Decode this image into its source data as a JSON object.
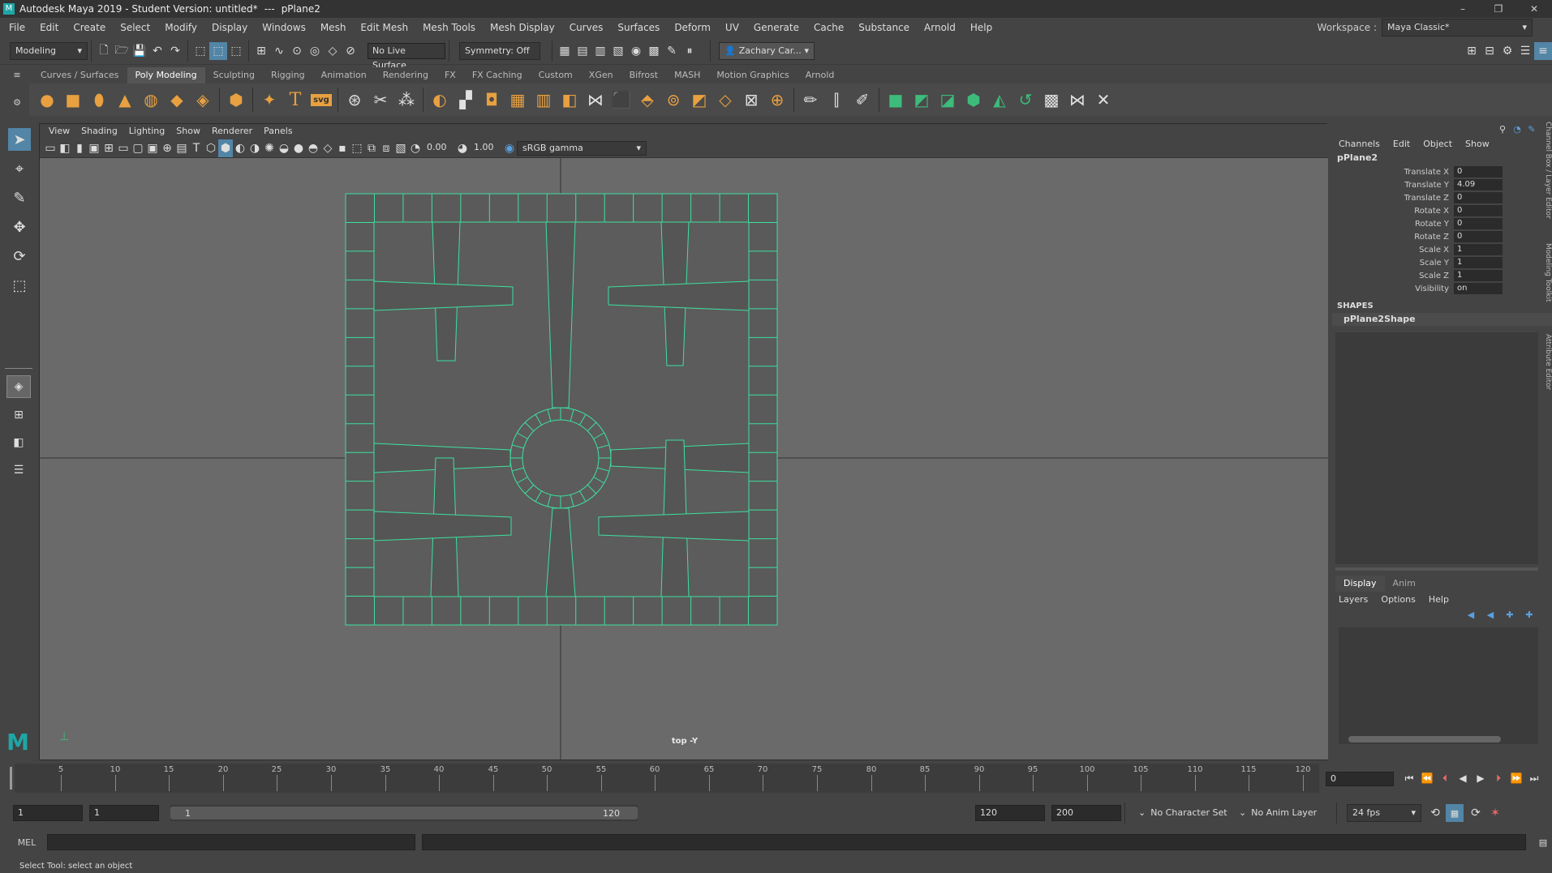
{
  "title_bar": {
    "app_title": "Autodesk Maya 2019 - Student Version: untitled*",
    "separator": "---",
    "object": "pPlane2",
    "minimize": "–",
    "maximize": "❐",
    "close": "✕"
  },
  "menubar": {
    "items": [
      "File",
      "Edit",
      "Create",
      "Select",
      "Modify",
      "Display",
      "Windows",
      "Mesh",
      "Edit Mesh",
      "Mesh Tools",
      "Mesh Display",
      "Curves",
      "Surfaces",
      "Deform",
      "UV",
      "Generate",
      "Cache",
      "Substance",
      "Arnold",
      "Help"
    ],
    "workspace_label": "Workspace :",
    "workspace_value": "Maya Classic*"
  },
  "status_line": {
    "menu_set": "Modeling",
    "live_surface": "No Live Surface",
    "symmetry": "Symmetry: Off",
    "user": "Zachary Car..."
  },
  "shelf": {
    "tabs": [
      "Curves / Surfaces",
      "Poly Modeling",
      "Sculpting",
      "Rigging",
      "Animation",
      "Rendering",
      "FX",
      "FX Caching",
      "Custom",
      "XGen",
      "Bifrost",
      "MASH",
      "Motion Graphics",
      "Arnold"
    ],
    "active_tab": "Poly Modeling",
    "text_icon": "T",
    "svg_icon": "svg"
  },
  "viewport": {
    "menus": [
      "View",
      "Shading",
      "Lighting",
      "Show",
      "Renderer",
      "Panels"
    ],
    "exposure": "0.00",
    "gamma": "1.00",
    "color_space": "sRGB gamma",
    "camera_label": "top -Y",
    "wire_color": "#3de0a0"
  },
  "channel_box": {
    "menus": [
      "Channels",
      "Edit",
      "Object",
      "Show"
    ],
    "object_name": "pPlane2",
    "channels": [
      {
        "label": "Translate X",
        "value": "0"
      },
      {
        "label": "Translate Y",
        "value": "4.09"
      },
      {
        "label": "Translate Z",
        "value": "0"
      },
      {
        "label": "Rotate X",
        "value": "0"
      },
      {
        "label": "Rotate Y",
        "value": "0"
      },
      {
        "label": "Rotate Z",
        "value": "0"
      },
      {
        "label": "Scale X",
        "value": "1"
      },
      {
        "label": "Scale Y",
        "value": "1"
      },
      {
        "label": "Scale Z",
        "value": "1"
      },
      {
        "label": "Visibility",
        "value": "on"
      }
    ],
    "shapes_header": "SHAPES",
    "shape_name": "pPlane2Shape",
    "side_tabs": [
      "Channel Box / Layer Editor",
      "Modeling Toolkit",
      "Attribute Editor"
    ]
  },
  "layer_editor": {
    "tabs": [
      "Display",
      "Anim"
    ],
    "active_tab": "Display",
    "menus": [
      "Layers",
      "Options",
      "Help"
    ]
  },
  "timeline": {
    "ticks": [
      "5",
      "10",
      "15",
      "20",
      "25",
      "30",
      "35",
      "40",
      "45",
      "50",
      "55",
      "60",
      "65",
      "70",
      "75",
      "80",
      "85",
      "90",
      "95",
      "100",
      "105",
      "110",
      "115",
      "120"
    ],
    "current_frame": "0"
  },
  "range": {
    "start": "1",
    "playback_start": "1",
    "slider_start": "1",
    "slider_end": "120",
    "playback_end": "120",
    "end": "200",
    "character_set": "No Character Set",
    "anim_layer": "No Anim Layer",
    "fps": "24 fps"
  },
  "command_line": {
    "language": "MEL"
  },
  "help_line": {
    "text": "Select Tool: select an object"
  }
}
